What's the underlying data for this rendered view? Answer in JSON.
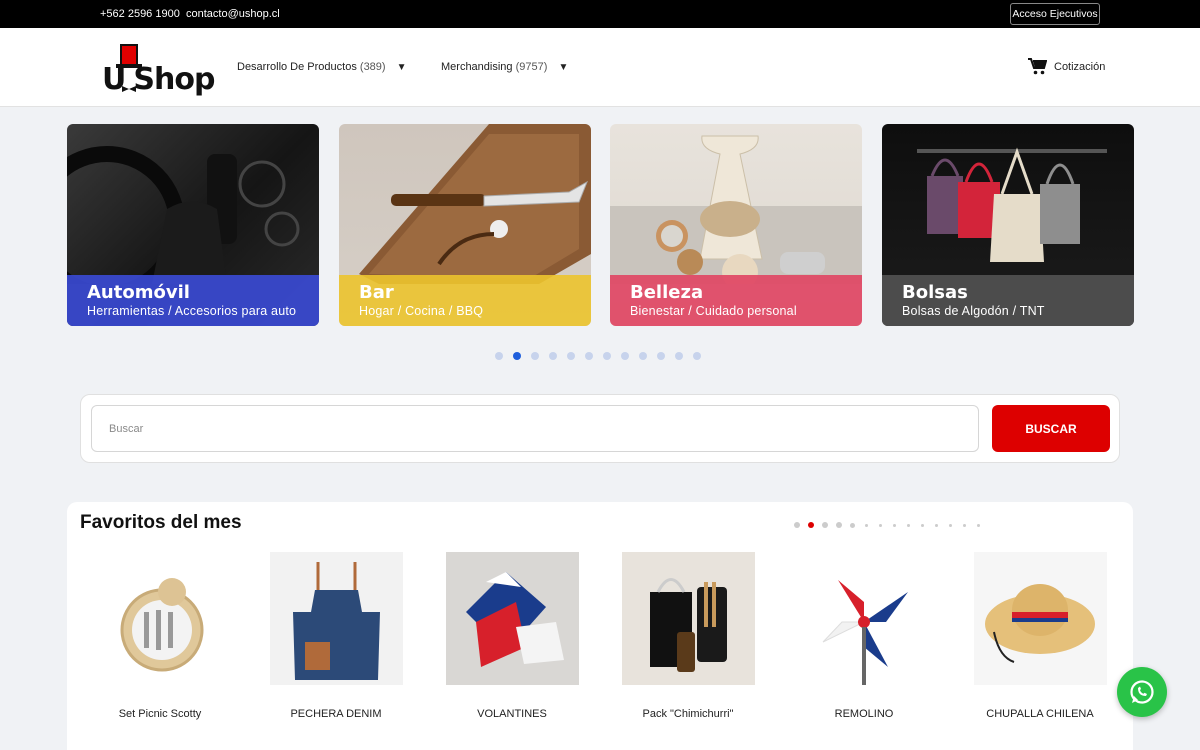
{
  "topbar": {
    "phone": "+562 2596 1900",
    "email": "contacto@ushop.cl",
    "exec_button": "Acceso Ejecutivos"
  },
  "header": {
    "logo_text": "UShop",
    "nav": [
      {
        "label": "Desarrollo De Productos",
        "count": "(389)"
      },
      {
        "label": "Merchandising",
        "count": "(9757)"
      }
    ],
    "quote_label": "Cotización"
  },
  "categories": [
    {
      "title": "Automóvil",
      "subtitle": "Herramientas / Accesorios para auto",
      "color": "#3a4ad2"
    },
    {
      "title": "Bar",
      "subtitle": "Hogar / Cocina / BBQ",
      "color": "#ecc42e"
    },
    {
      "title": "Belleza",
      "subtitle": "Bienestar / Cuidado personal",
      "color": "#e04664"
    },
    {
      "title": "Bolsas",
      "subtitle": "Bolsas de Algodón / TNT",
      "color": "#505050"
    }
  ],
  "carousel": {
    "dot_count": 12,
    "active_index": 1
  },
  "search": {
    "placeholder": "Buscar",
    "button": "BUSCAR"
  },
  "favorites": {
    "title": "Favoritos del mes",
    "active_dot": 1,
    "products": [
      {
        "name": "Set Picnic Scotty"
      },
      {
        "name": "PECHERA DENIM"
      },
      {
        "name": "VOLANTINES"
      },
      {
        "name": "Pack \"Chimichurri\""
      },
      {
        "name": "REMOLINO"
      },
      {
        "name": "CHUPALLA CHILENA"
      }
    ]
  },
  "colors": {
    "accent": "#dd0000",
    "whatsapp": "#29c348",
    "carousel_active": "#1f5fdc"
  },
  "icons": [
    "cart-icon",
    "whatsapp-icon",
    "dropdown-arrow-icon"
  ]
}
